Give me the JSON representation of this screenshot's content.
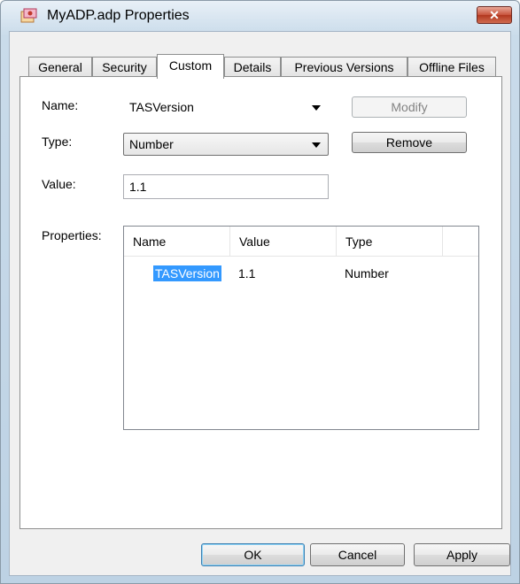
{
  "window": {
    "title": "MyADP.adp Properties",
    "close_glyph": "✕"
  },
  "tabs": [
    {
      "label": "General"
    },
    {
      "label": "Security"
    },
    {
      "label": "Custom",
      "active": true
    },
    {
      "label": "Details"
    },
    {
      "label": "Previous Versions"
    },
    {
      "label": "Offline Files"
    }
  ],
  "form": {
    "name_label": "Name:",
    "name_value": "TASVersion",
    "type_label": "Type:",
    "type_value": "Number",
    "value_label": "Value:",
    "value_value": "1.1",
    "properties_label": "Properties:"
  },
  "side_buttons": {
    "modify": "Modify",
    "remove": "Remove"
  },
  "properties_list": {
    "columns": [
      "Name",
      "Value",
      "Type"
    ],
    "rows": [
      {
        "name": "TASVersion",
        "value": "1.1",
        "type": "Number",
        "selected": true
      }
    ]
  },
  "dialog_buttons": {
    "ok": "OK",
    "cancel": "Cancel",
    "apply": "Apply"
  },
  "colors": {
    "selection": "#3399ff",
    "close_button": "#c7513a"
  }
}
